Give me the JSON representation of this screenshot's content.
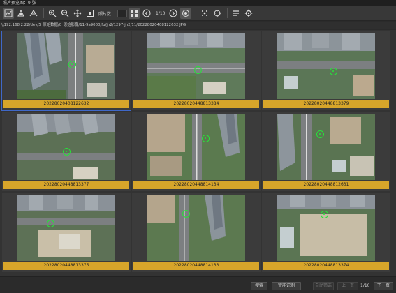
{
  "window": {
    "title": "照片预览图：9 张"
  },
  "toolbar": {
    "icons": [
      "thumbnail-view-icon",
      "detail-view-icon",
      "map-view-icon",
      "zoom-in-icon",
      "zoom-out-icon",
      "pan-icon",
      "fit-icon",
      "grid-icon",
      "prev-page-icon",
      "next-page-icon",
      "focus-icon",
      "scatter-icon",
      "target-icon",
      "list-icon",
      "settings-icon"
    ],
    "photos_per_row_label": "照片数：",
    "page_indicator": "1/10"
  },
  "path": "\\\\192.168.2.22/dev/5_原始数据/0_原始影像/11-9a9000/fu/jn2/1297-jn2/11/20228020408122632.JPG",
  "photos": [
    {
      "name": "20228020408122632",
      "selected": true
    },
    {
      "name": "20228020448813384",
      "selected": false
    },
    {
      "name": "20228020448813379",
      "selected": false
    },
    {
      "name": "20228020448813377",
      "selected": false
    },
    {
      "name": "20228020448814134",
      "selected": false
    },
    {
      "name": "20228020448812631",
      "selected": false
    },
    {
      "name": "20228020448813375",
      "selected": false
    },
    {
      "name": "20228020448814133",
      "selected": false
    },
    {
      "name": "20228020448813374",
      "selected": false
    }
  ],
  "footer": {
    "search_label": "搜索",
    "smart_search_label": "智能识别",
    "btn3_label": "自动筛选",
    "prev_label": "上一页",
    "page_total": "1/10",
    "next_label": "下一页"
  },
  "colors": {
    "caption_bg": "#d7a52a",
    "marker": "#27e23a",
    "selection": "#3f68c9"
  }
}
